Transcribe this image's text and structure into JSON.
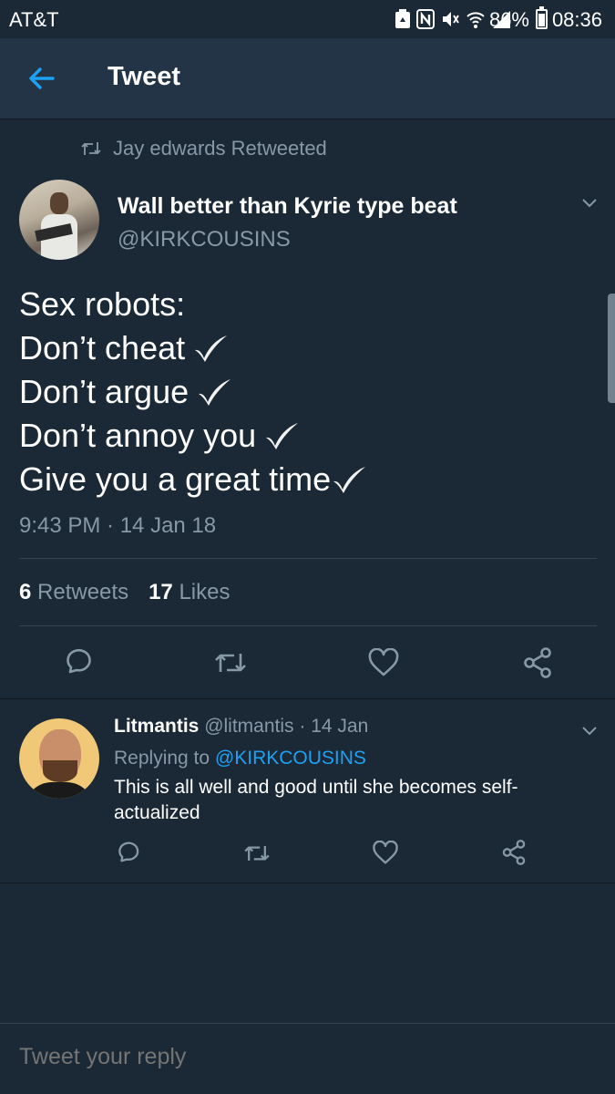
{
  "status_bar": {
    "carrier": "AT&T",
    "battery": "86%",
    "time": "08:36"
  },
  "header": {
    "title": "Tweet"
  },
  "tweet": {
    "retweeted_by": "Jay edwards Retweeted",
    "author_name": "Wall better than Kyrie type beat",
    "author_handle": "@KIRKCOUSINS",
    "lines": [
      "Sex robots:",
      "Don’t cheat",
      "Don’t argue",
      "Don’t annoy you",
      "Give you a great time"
    ],
    "timestamp": "9:43 PM · 14 Jan 18",
    "retweet_count": "6",
    "retweet_label": "Retweets",
    "like_count": "17",
    "like_label": "Likes"
  },
  "reply": {
    "name": "Litmantis",
    "handle": "@litmantis",
    "date": "· 14 Jan",
    "replying_label": "Replying to",
    "replying_to": "@KIRKCOUSINS",
    "text": "This is all well and good until she becomes self-actualized"
  },
  "composer": {
    "placeholder": "Tweet your reply"
  },
  "colors": {
    "background": "#1b2836",
    "header": "#243447",
    "secondary_text": "#8899a6",
    "accent": "#1da1f2"
  }
}
